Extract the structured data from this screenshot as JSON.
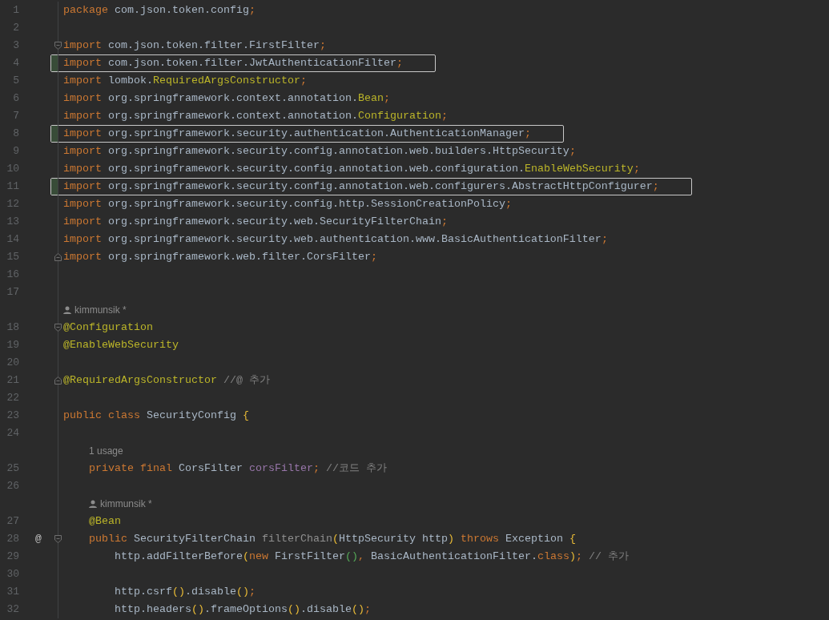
{
  "editor": {
    "lines": [
      {
        "number": "1",
        "highlighted": false,
        "tokens": [
          {
            "kind": "keyword",
            "text": "package "
          },
          {
            "kind": "plain",
            "text": "com.json.token.config"
          },
          {
            "kind": "keyword",
            "text": ";"
          }
        ]
      },
      {
        "number": "2",
        "highlighted": false
      },
      {
        "number": "3",
        "highlighted": false,
        "fold": {
          "kind": "start"
        },
        "tokens": [
          {
            "kind": "keyword",
            "text": "import "
          },
          {
            "kind": "plain",
            "text": "com.json.token.filter.FirstFilter"
          },
          {
            "kind": "keyword",
            "text": ";"
          }
        ]
      },
      {
        "number": "4",
        "highlighted": true,
        "tokens": [
          {
            "kind": "keyword",
            "text": "import "
          },
          {
            "kind": "plain",
            "text": "com.json.token.filter.JwtAuthenticationFilter"
          },
          {
            "kind": "keyword",
            "text": ";"
          }
        ]
      },
      {
        "number": "5",
        "highlighted": false,
        "tokens": [
          {
            "kind": "keyword",
            "text": "import "
          },
          {
            "kind": "plain",
            "text": "lombok."
          },
          {
            "kind": "annotation",
            "text": "RequiredArgsConstructor"
          },
          {
            "kind": "keyword",
            "text": ";"
          }
        ]
      },
      {
        "number": "6",
        "highlighted": false,
        "tokens": [
          {
            "kind": "keyword",
            "text": "import "
          },
          {
            "kind": "plain",
            "text": "org.springframework.context.annotation."
          },
          {
            "kind": "annotation",
            "text": "Bean"
          },
          {
            "kind": "keyword",
            "text": ";"
          }
        ]
      },
      {
        "number": "7",
        "highlighted": false,
        "tokens": [
          {
            "kind": "keyword",
            "text": "import "
          },
          {
            "kind": "plain",
            "text": "org.springframework.context.annotation."
          },
          {
            "kind": "annotation",
            "text": "Configuration"
          },
          {
            "kind": "keyword",
            "text": ";"
          }
        ]
      },
      {
        "number": "8",
        "highlighted": true,
        "tokens": [
          {
            "kind": "keyword",
            "text": "import "
          },
          {
            "kind": "plain",
            "text": "org.springframework.security.authentication.AuthenticationManager"
          },
          {
            "kind": "keyword",
            "text": ";"
          }
        ]
      },
      {
        "number": "9",
        "highlighted": false,
        "tokens": [
          {
            "kind": "keyword",
            "text": "import "
          },
          {
            "kind": "plain",
            "text": "org.springframework.security.config.annotation.web.builders.HttpSecurity"
          },
          {
            "kind": "keyword",
            "text": ";"
          }
        ]
      },
      {
        "number": "10",
        "highlighted": false,
        "tokens": [
          {
            "kind": "keyword",
            "text": "import "
          },
          {
            "kind": "plain",
            "text": "org.springframework.security.config.annotation.web.configuration."
          },
          {
            "kind": "annotation",
            "text": "EnableWebSecurity"
          },
          {
            "kind": "keyword",
            "text": ";"
          }
        ]
      },
      {
        "number": "11",
        "highlighted": true,
        "tokens": [
          {
            "kind": "keyword",
            "text": "import "
          },
          {
            "kind": "plain",
            "text": "org.springframework.security.config.annotation.web.configurers.AbstractHttpConfigurer"
          },
          {
            "kind": "keyword",
            "text": ";"
          }
        ]
      },
      {
        "number": "12",
        "highlighted": false,
        "tokens": [
          {
            "kind": "keyword",
            "text": "import "
          },
          {
            "kind": "plain",
            "text": "org.springframework.security.config.http.SessionCreationPolicy"
          },
          {
            "kind": "keyword",
            "text": ";"
          }
        ]
      },
      {
        "number": "13",
        "highlighted": false,
        "tokens": [
          {
            "kind": "keyword",
            "text": "import "
          },
          {
            "kind": "plain",
            "text": "org.springframework.security.web.SecurityFilterChain"
          },
          {
            "kind": "keyword",
            "text": ";"
          }
        ]
      },
      {
        "number": "14",
        "highlighted": false,
        "tokens": [
          {
            "kind": "keyword",
            "text": "import "
          },
          {
            "kind": "plain",
            "text": "org.springframework.security.web.authentication.www.BasicAuthenticationFilter"
          },
          {
            "kind": "keyword",
            "text": ";"
          }
        ]
      },
      {
        "number": "15",
        "highlighted": false,
        "fold": {
          "kind": "end"
        },
        "tokens": [
          {
            "kind": "keyword",
            "text": "import "
          },
          {
            "kind": "plain",
            "text": "org.springframework.web.filter.CorsFilter"
          },
          {
            "kind": "keyword",
            "text": ";"
          }
        ]
      },
      {
        "number": "16",
        "highlighted": false
      },
      {
        "number": "17",
        "highlighted": false
      },
      {
        "number": "18",
        "highlighted": false,
        "fold": {
          "kind": "start"
        },
        "inlay": {
          "kind": "author",
          "text": "kimmunsik *"
        },
        "tokens": [
          {
            "kind": "annotation",
            "text": "@Configuration"
          }
        ]
      },
      {
        "number": "19",
        "highlighted": false,
        "tokens": [
          {
            "kind": "annotation",
            "text": "@EnableWebSecurity"
          }
        ]
      },
      {
        "number": "20",
        "highlighted": false
      },
      {
        "number": "21",
        "highlighted": false,
        "fold": {
          "kind": "end"
        },
        "tokens": [
          {
            "kind": "annotation",
            "text": "@RequiredArgsConstructor"
          },
          {
            "kind": "comment",
            "text": " //@ 추가"
          }
        ]
      },
      {
        "number": "22",
        "highlighted": false
      },
      {
        "number": "23",
        "highlighted": false,
        "tokens": [
          {
            "kind": "keyword",
            "text": "public class "
          },
          {
            "kind": "plain",
            "text": "SecurityConfig "
          },
          {
            "kind": "bracket",
            "text": "{"
          }
        ]
      },
      {
        "number": "24",
        "highlighted": false
      },
      {
        "number": "25",
        "highlighted": false,
        "inlay": {
          "kind": "usage",
          "text": "1 usage"
        },
        "tokens": [
          {
            "kind": "keyword",
            "text": "    private final "
          },
          {
            "kind": "plain",
            "text": "CorsFilter "
          },
          {
            "kind": "field",
            "text": "corsFilter"
          },
          {
            "kind": "keyword",
            "text": ";"
          },
          {
            "kind": "comment",
            "text": " //코드 추가"
          }
        ]
      },
      {
        "number": "26",
        "highlighted": false
      },
      {
        "number": "27",
        "highlighted": false,
        "inlay": {
          "kind": "author",
          "text": "kimmunsik *"
        },
        "tokens": [
          {
            "kind": "annotation",
            "text": "    @Bean"
          }
        ]
      },
      {
        "number": "28",
        "highlighted": false,
        "fold": {
          "kind": "start"
        },
        "gutter_mark": "@",
        "tokens": [
          {
            "kind": "keyword",
            "text": "    public "
          },
          {
            "kind": "plain",
            "text": "SecurityFilterChain "
          },
          {
            "kind": "unused",
            "text": "filterChain"
          },
          {
            "kind": "bracket",
            "text": "("
          },
          {
            "kind": "plain",
            "text": "HttpSecurity http"
          },
          {
            "kind": "bracket",
            "text": ")"
          },
          {
            "kind": "keyword",
            "text": " throws "
          },
          {
            "kind": "plain",
            "text": "Exception "
          },
          {
            "kind": "bracket",
            "text": "{"
          }
        ]
      },
      {
        "number": "29",
        "highlighted": false,
        "tokens": [
          {
            "kind": "plain",
            "text": "        http.addFilterBefore"
          },
          {
            "kind": "bracket",
            "text": "("
          },
          {
            "kind": "keyword",
            "text": "new "
          },
          {
            "kind": "plain",
            "text": "FirstFilter"
          },
          {
            "kind": "bracket2",
            "text": "()"
          },
          {
            "kind": "keyword",
            "text": ", "
          },
          {
            "kind": "plain",
            "text": "BasicAuthenticationFilter."
          },
          {
            "kind": "keyword",
            "text": "class"
          },
          {
            "kind": "bracket",
            "text": ")"
          },
          {
            "kind": "keyword",
            "text": ";"
          },
          {
            "kind": "comment",
            "text": " // 추가"
          }
        ]
      },
      {
        "number": "30",
        "highlighted": false
      },
      {
        "number": "31",
        "highlighted": false,
        "tokens": [
          {
            "kind": "plain",
            "text": "        http.csrf"
          },
          {
            "kind": "bracket",
            "text": "()"
          },
          {
            "kind": "plain",
            "text": ".disable"
          },
          {
            "kind": "bracket",
            "text": "()"
          },
          {
            "kind": "keyword",
            "text": ";"
          }
        ]
      },
      {
        "number": "32",
        "highlighted": false,
        "tokens": [
          {
            "kind": "plain",
            "text": "        http.headers"
          },
          {
            "kind": "bracket",
            "text": "()"
          },
          {
            "kind": "plain",
            "text": ".frameOptions"
          },
          {
            "kind": "bracket",
            "text": "()"
          },
          {
            "kind": "plain",
            "text": ".disable"
          },
          {
            "kind": "bracket",
            "text": "()"
          },
          {
            "kind": "keyword",
            "text": ";"
          }
        ]
      }
    ]
  }
}
